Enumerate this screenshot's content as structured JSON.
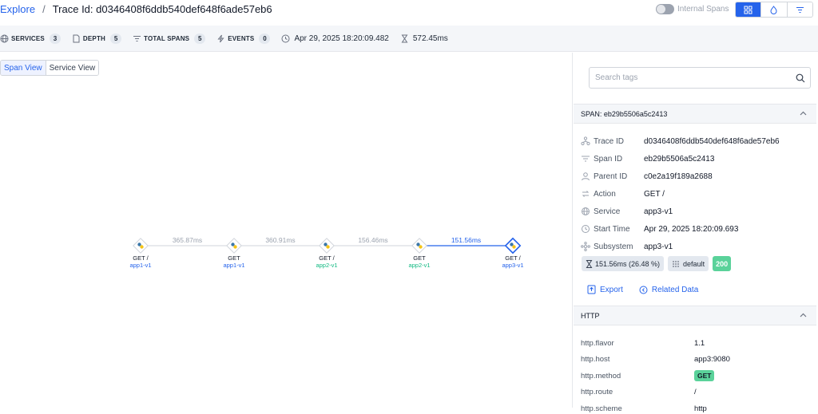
{
  "breadcrumb": {
    "root": "Explore",
    "separator": "/",
    "current": "Trace Id: d0346408f6ddb540def648f6ade57eb6"
  },
  "toggle": {
    "label": "Internal Spans",
    "on": false
  },
  "stats": {
    "services": {
      "label": "SERVICES",
      "count": "3"
    },
    "depth": {
      "label": "DEPTH",
      "count": "5"
    },
    "total_spans": {
      "label": "TOTAL SPANS",
      "count": "5"
    },
    "events": {
      "label": "EVENTS",
      "count": "0"
    },
    "start": "Apr 29, 2025 18:20:09.482",
    "duration": "572.45ms"
  },
  "view_toggle": {
    "span_view": "Span View",
    "service_view": "Service View"
  },
  "graph": {
    "nodes": [
      {
        "action": "GET /",
        "service": "app1-v1",
        "color": "#2563eb"
      },
      {
        "action": "GET",
        "service": "app1-v1",
        "color": "#2563eb"
      },
      {
        "action": "GET /",
        "service": "app2-v1",
        "color": "#10b981"
      },
      {
        "action": "GET",
        "service": "app2-v1",
        "color": "#10b981"
      },
      {
        "action": "GET /",
        "service": "app3-v1",
        "color": "#2563eb"
      }
    ],
    "edges": [
      "365.87ms",
      "360.91ms",
      "156.46ms",
      "151.56ms"
    ]
  },
  "search": {
    "placeholder": "Search tags"
  },
  "span_section": {
    "title": "SPAN: eb29b5506a5c2413",
    "fields": [
      {
        "icon": "trace-icon",
        "key": "Trace ID",
        "value": "d0346408f6ddb540def648f6ade57eb6"
      },
      {
        "icon": "span-icon",
        "key": "Span ID",
        "value": "eb29b5506a5c2413"
      },
      {
        "icon": "parent-icon",
        "key": "Parent ID",
        "value": "c0e2a19f189a2688"
      },
      {
        "icon": "action-icon",
        "key": "Action",
        "value": "GET /"
      },
      {
        "icon": "service-icon",
        "key": "Service",
        "value": "app3-v1"
      },
      {
        "icon": "clock-icon",
        "key": "Start Time",
        "value": "Apr 29, 2025 18:20:09.693"
      },
      {
        "icon": "subsystem-icon",
        "key": "Subsystem",
        "value": "app3-v1"
      }
    ],
    "duration_chip": "151.56ms (26.48 %)",
    "namespace_chip": "default",
    "status_chip": "200",
    "export": "Export",
    "related": "Related Data"
  },
  "http_section": {
    "title": "HTTP",
    "fields": [
      {
        "key": "http.flavor",
        "value": "1.1"
      },
      {
        "key": "http.host",
        "value": "app3:9080"
      },
      {
        "key": "http.method",
        "value": "GET"
      },
      {
        "key": "http.route",
        "value": "/"
      },
      {
        "key": "http.scheme",
        "value": "http"
      }
    ]
  },
  "colors": {
    "accent": "#2563eb",
    "success": "#5ad29a",
    "panel": "#f4f6f9"
  }
}
